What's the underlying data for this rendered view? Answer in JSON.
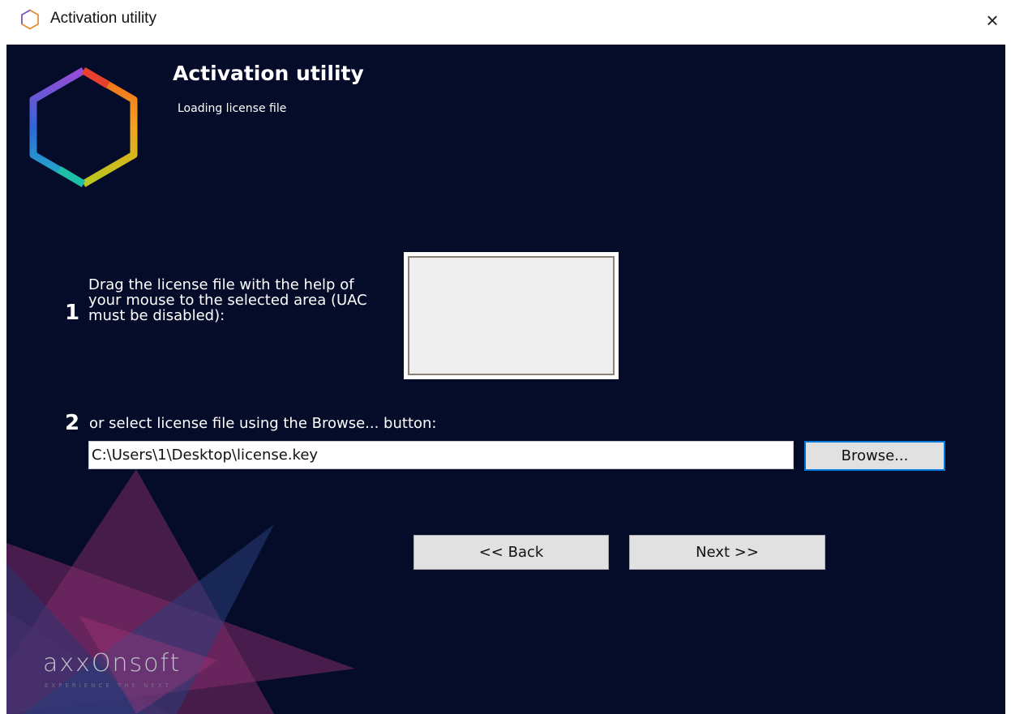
{
  "window": {
    "title": "Activation utility",
    "close_glyph": "×",
    "icon": "hexagon-icon"
  },
  "header": {
    "title": "Activation utility",
    "subtitle": "Loading license file",
    "logo": "hexagon-logo-icon"
  },
  "step1": {
    "number": "1",
    "text": "Drag the license file with the help of your mouse to the selected area (UAC must be disabled):"
  },
  "step2": {
    "number": "2",
    "text": "or select license file using the Browse... button:"
  },
  "path_input": {
    "value": "C:\\Users\\1\\Desktop\\license.key"
  },
  "buttons": {
    "browse": "Browse...",
    "back": "<< Back",
    "next": "Next >>"
  },
  "brand": {
    "name": "axxOnsoft",
    "tagline": "EXPERIENCE THE NEXT"
  },
  "colors": {
    "background": "#050c2a",
    "accent": "#0078d7",
    "deco_magenta": "#8c2c6e",
    "deco_blue": "#2a3e7c"
  }
}
